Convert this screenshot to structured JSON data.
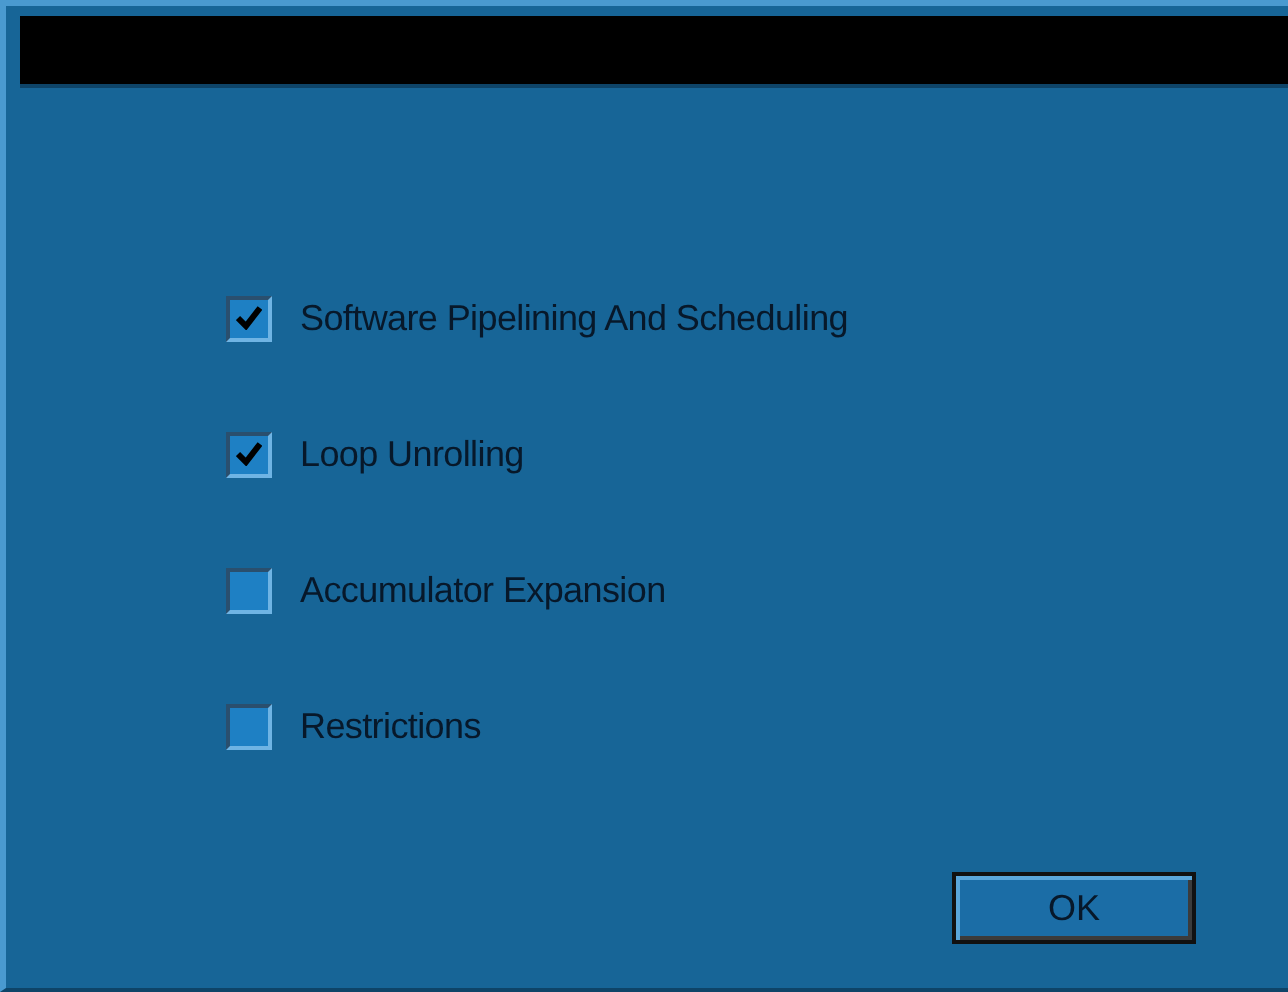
{
  "options": [
    {
      "label": "Software Pipelining And Scheduling",
      "checked": true
    },
    {
      "label": "Loop Unrolling",
      "checked": true
    },
    {
      "label": "Accumulator Expansion",
      "checked": false
    },
    {
      "label": "Restrictions",
      "checked": false
    }
  ],
  "buttons": [
    "OK"
  ]
}
